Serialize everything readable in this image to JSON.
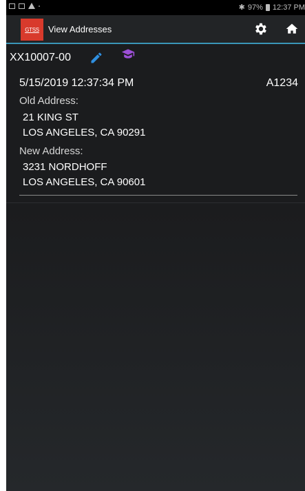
{
  "status_bar": {
    "battery": "97%",
    "time": "12:37 PM"
  },
  "app_bar": {
    "logo_text": "GTSS",
    "title": "View Addresses",
    "icons": [
      "gear-icon",
      "home-icon"
    ]
  },
  "record": {
    "id": "XX10007-00",
    "icons": [
      "pencil-icon",
      "graduation-cap-icon"
    ],
    "accent_color": "#2f8fe0",
    "badge_color": "#9c4fd6"
  },
  "entry": {
    "timestamp": "5/15/2019 12:37:34 PM",
    "code": "A1234",
    "old_label": "Old Address:",
    "old_line1": "21 KING ST",
    "old_line2": "LOS ANGELES, CA 90291",
    "new_label": "New Address:",
    "new_line1": "3231 NORDHOFF",
    "new_line2": "LOS ANGELES, CA 90601"
  },
  "colors": {
    "brand": "#d83a2c",
    "app_bar_accent": "#3a96b8"
  }
}
